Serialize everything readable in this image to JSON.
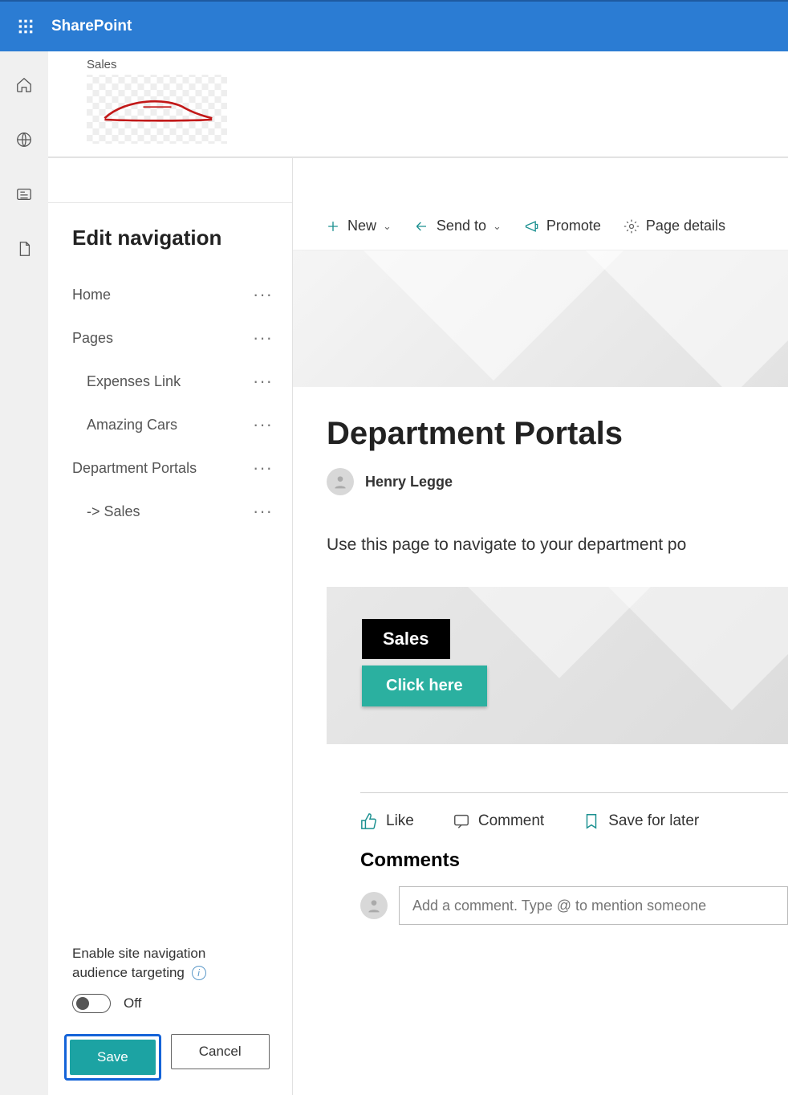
{
  "suite": {
    "product": "SharePoint"
  },
  "site": {
    "small_label": "Sales"
  },
  "cmdbar": {
    "new": "New",
    "sendto": "Send to",
    "promote": "Promote",
    "details": "Page details"
  },
  "editnav": {
    "title": "Edit navigation",
    "items": [
      {
        "label": "Home",
        "indent": false
      },
      {
        "label": "Pages",
        "indent": false
      },
      {
        "label": "Expenses Link",
        "indent": true
      },
      {
        "label": "Amazing Cars",
        "indent": true
      },
      {
        "label": "Department Portals",
        "indent": false
      },
      {
        "label": "-> Sales",
        "indent": true
      }
    ],
    "audience_line1": "Enable site navigation",
    "audience_line2": "audience targeting",
    "toggle_label": "Off",
    "save": "Save",
    "cancel": "Cancel"
  },
  "page": {
    "title": "Department Portals",
    "author": "Henry Legge",
    "desc": "Use this page to navigate to your department po",
    "tile_tag": "Sales",
    "tile_btn": "Click here"
  },
  "social": {
    "like": "Like",
    "comment": "Comment",
    "save": "Save for later"
  },
  "comments": {
    "heading": "Comments",
    "placeholder": "Add a comment. Type @ to mention someone"
  }
}
